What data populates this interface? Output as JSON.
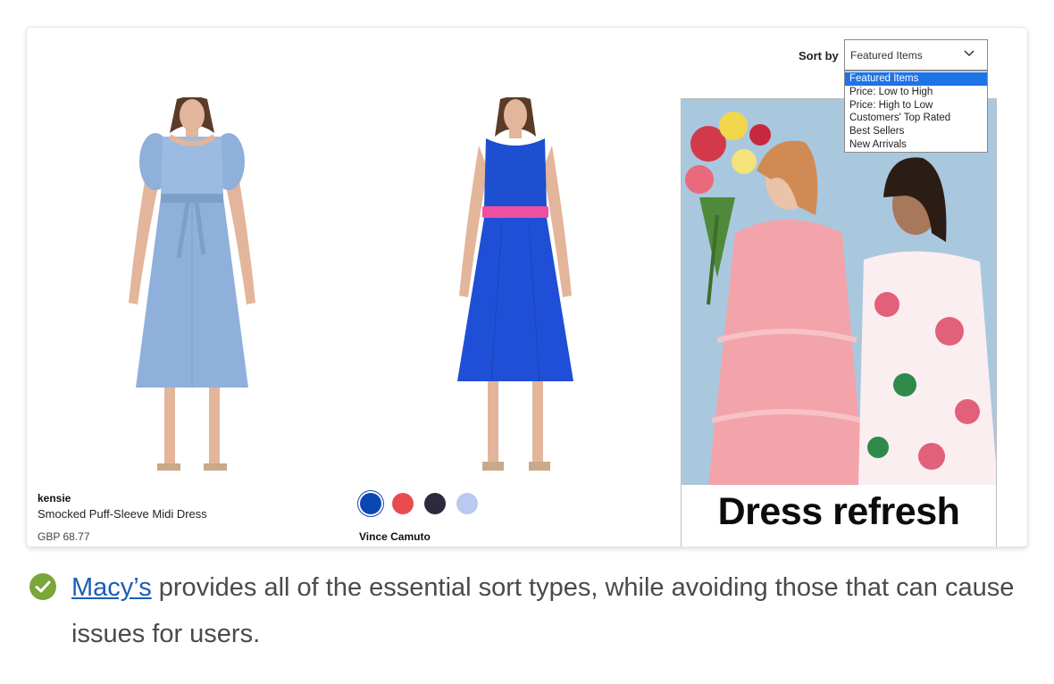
{
  "sort": {
    "label": "Sort by",
    "selected": "Featured Items",
    "options": [
      "Featured Items",
      "Price: Low to High",
      "Price: High to Low",
      "Customers' Top Rated",
      "Best Sellers",
      "New Arrivals"
    ]
  },
  "products": [
    {
      "brand": "kensie",
      "name": "Smocked Puff-Sleeve Midi Dress",
      "price": "GBP 68.77"
    },
    {
      "brand": "Vince Camuto",
      "swatches": [
        "#0b47b3",
        "#e94b4f",
        "#2b2b3d",
        "#b9c9ef"
      ]
    }
  ],
  "promo": {
    "title": "Dress refresh"
  },
  "caption": {
    "link": "Macy’s",
    "text": " provides all of the essential sort types, while avoiding those that can cause issues for users."
  },
  "colors": {
    "accent": "#1e73e8",
    "link": "#1a5fb4",
    "check": "#7aa63a"
  }
}
